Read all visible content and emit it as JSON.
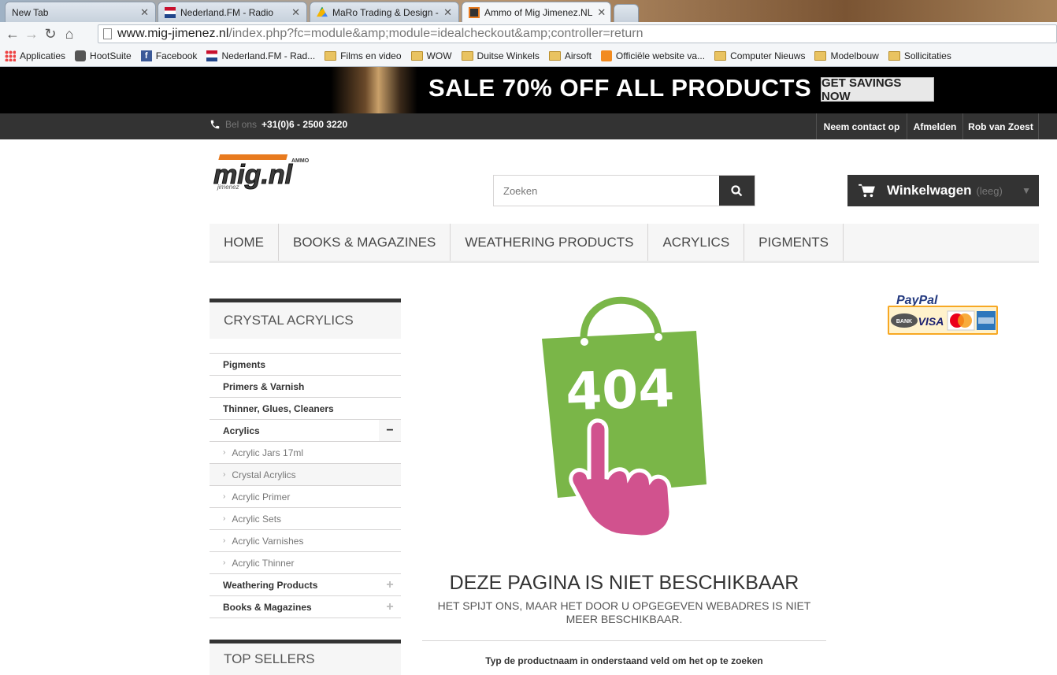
{
  "browser": {
    "tabs": [
      {
        "title": "New Tab"
      },
      {
        "title": "Nederland.FM - Radio"
      },
      {
        "title": "MaRo Trading & Design -"
      },
      {
        "title": "Ammo of Mig Jimenez.NL"
      }
    ],
    "url_host": "www.mig-jimenez.nl",
    "url_rest": "/index.php?fc=module&amp;module=idealcheckout&amp;controller=return",
    "bookmarks": [
      {
        "label": "Applicaties",
        "icon": "apps-grid-icon"
      },
      {
        "label": "HootSuite",
        "icon": "hootsuite-icon"
      },
      {
        "label": "Facebook",
        "icon": "facebook-icon"
      },
      {
        "label": "Nederland.FM - Rad...",
        "icon": "nederland-fm-icon"
      },
      {
        "label": "Films en video",
        "icon": "folder-icon"
      },
      {
        "label": "WOW",
        "icon": "folder-icon"
      },
      {
        "label": "Duitse Winkels",
        "icon": "folder-icon"
      },
      {
        "label": "Airsoft",
        "icon": "folder-icon"
      },
      {
        "label": "Officiële website va...",
        "icon": "officiele-website-icon"
      },
      {
        "label": "Computer Nieuws",
        "icon": "folder-icon"
      },
      {
        "label": "Modelbouw",
        "icon": "folder-icon"
      },
      {
        "label": "Sollicitaties",
        "icon": "folder-icon"
      }
    ]
  },
  "banner": {
    "text": "SALE 70% OFF ALL PRODUCTS",
    "cta": "GET SAVINGS NOW"
  },
  "topnav": {
    "phone_label": "Bel ons",
    "phone_number": "+31(0)6 - 2500 3220",
    "links": [
      "Neem contact op",
      "Afmelden",
      "Rob van Zoest"
    ]
  },
  "header": {
    "logo_text": "mig.nl",
    "logo_small": "AMMO",
    "logo_sub": "jimenez",
    "search_placeholder": "Zoeken",
    "cart_label": "Winkelwagen",
    "cart_status": "(leeg)"
  },
  "menu": [
    "HOME",
    "BOOKS & MAGAZINES",
    "WEATHERING PRODUCTS",
    "ACRYLICS",
    "PIGMENTS"
  ],
  "sidebar": {
    "title": "CRYSTAL ACRYLICS",
    "categories": [
      {
        "label": "Pigments"
      },
      {
        "label": "Primers & Varnish"
      },
      {
        "label": "Thinner, Glues, Cleaners"
      },
      {
        "label": "Acrylics"
      },
      {
        "label": "Acrylic Jars 17ml"
      },
      {
        "label": "Crystal Acrylics"
      },
      {
        "label": "Acrylic Primer"
      },
      {
        "label": "Acrylic Sets"
      },
      {
        "label": "Acrylic Varnishes"
      },
      {
        "label": "Acrylic Thinner"
      },
      {
        "label": "Weathering Products"
      },
      {
        "label": "Books & Magazines"
      }
    ],
    "top_sellers_title": "TOP SELLERS"
  },
  "paypal": {
    "brand": "PayPal",
    "cards": [
      "BANK",
      "VISA"
    ]
  },
  "error": {
    "code": "404",
    "title": "DEZE PAGINA IS NIET BESCHIKBAAR",
    "subtitle": "HET SPIJT ONS, MAAR HET DOOR U OPGEGEVEN WEBADRES IS NIET MEER BESCHIKBAAR.",
    "hint": "Typ de productnaam in onderstaand veld om het op te zoeken"
  },
  "colors": {
    "dark": "#333333",
    "bag_green": "#7ab648",
    "hand_pink": "#d1528e"
  }
}
